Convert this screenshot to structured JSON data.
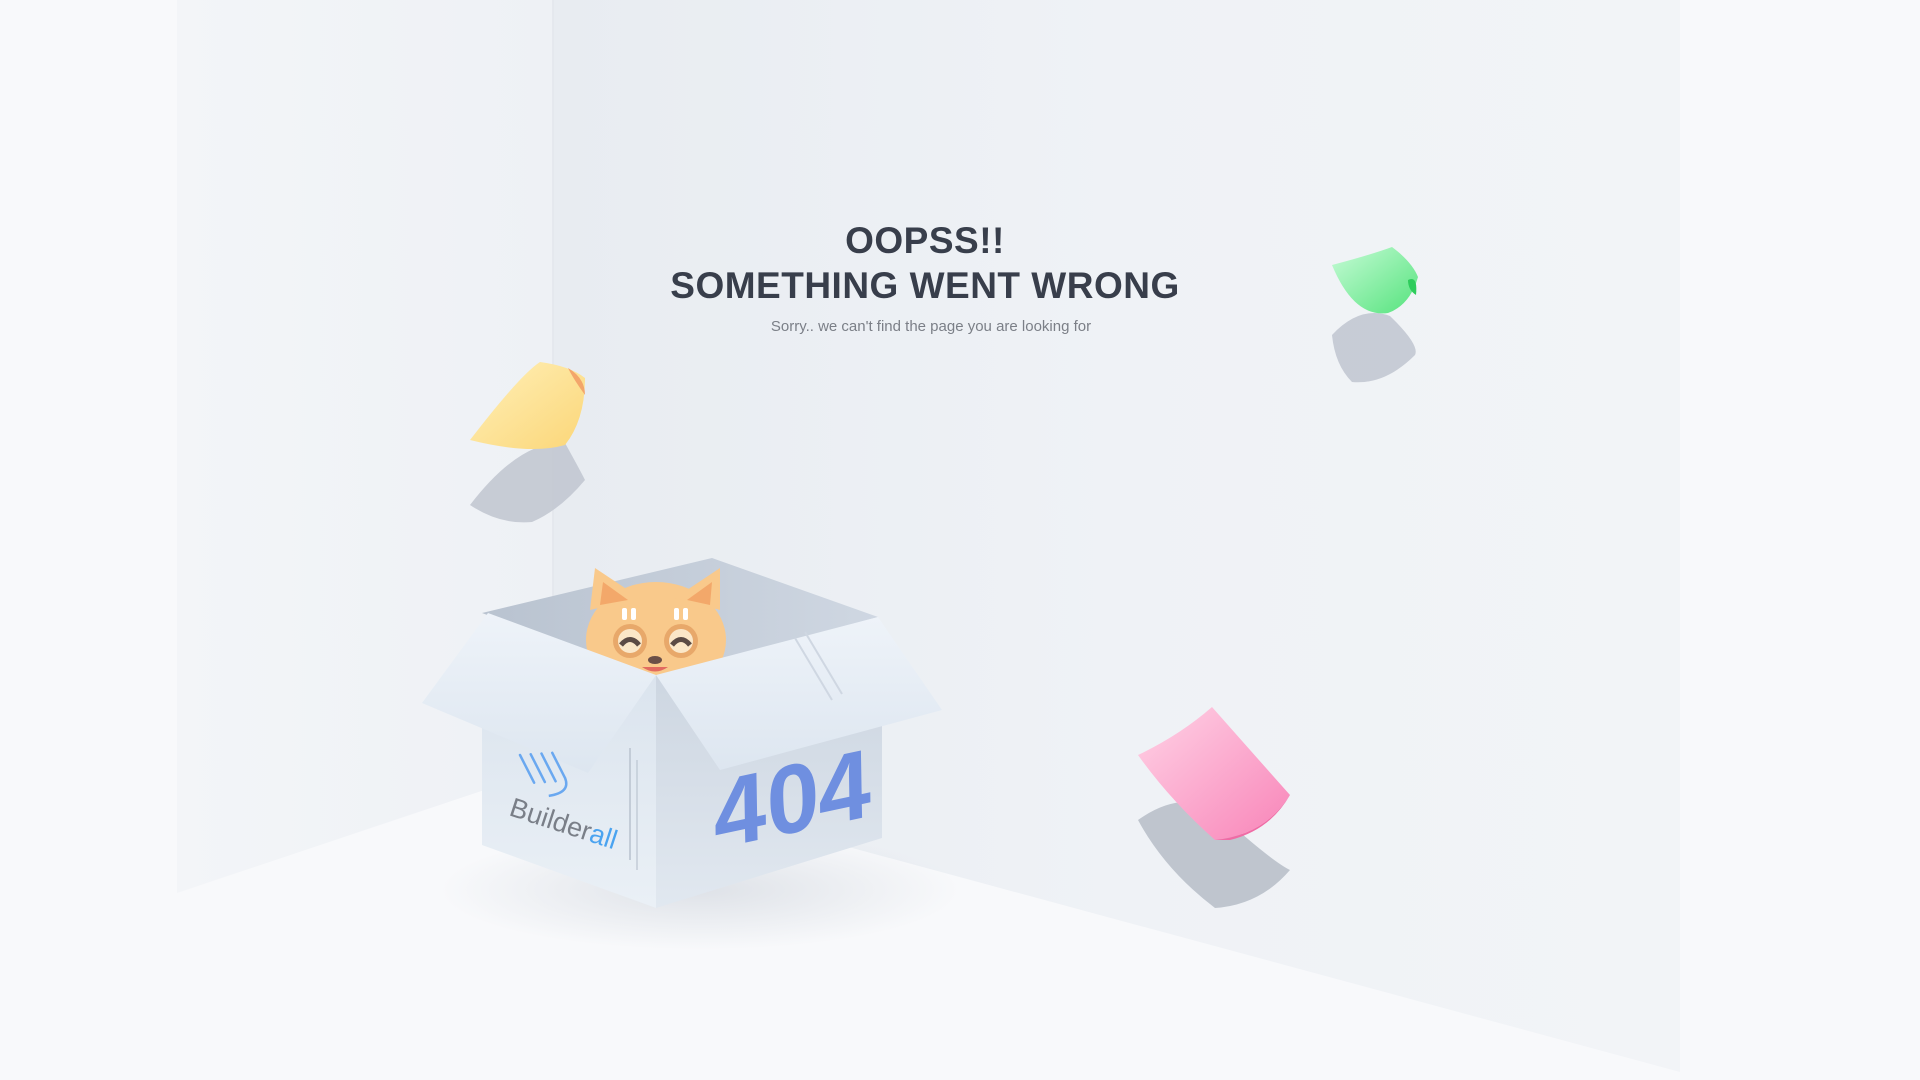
{
  "error_page": {
    "title_line1": "OOPSS!!",
    "title_line2": "SOMETHING WENT WRONG",
    "subtitle": "Sorry.. we can't find the page you are looking for"
  },
  "box": {
    "brand_prefix": "Builder",
    "brand_suffix": "all",
    "code": "404"
  },
  "colors": {
    "heading": "#383e4b",
    "subtitle": "#7b7f87",
    "code": "#6f8fe0",
    "brand_accent": "#4aa3f0",
    "note_yellow": "#fde39c",
    "note_green": "#7ef2a0",
    "note_pink": "#f99ac4"
  },
  "icons": [
    "builderall-logo-icon",
    "cat-illustration",
    "sticky-note-yellow",
    "sticky-note-green",
    "sticky-note-pink"
  ]
}
